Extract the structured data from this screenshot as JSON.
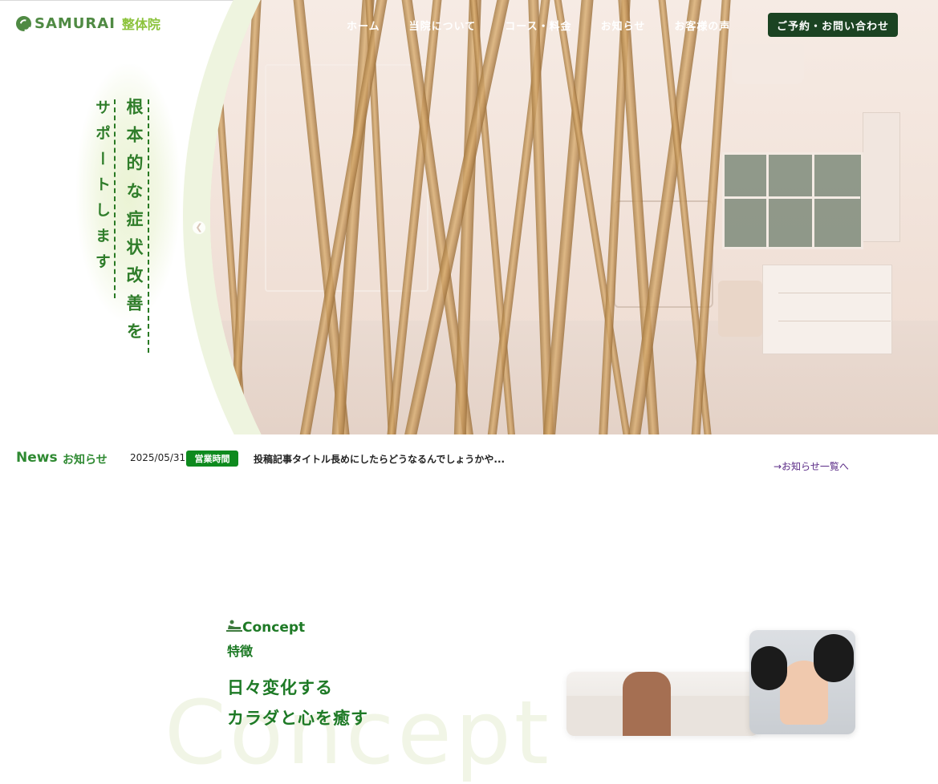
{
  "brand": {
    "logo_text": "SAMURAI",
    "logo_sub": "整体院",
    "color_primary": "#2f8a32",
    "color_logo": "#4f8a43",
    "color_logo_sub": "#8cc33c",
    "color_cta": "#1b4322"
  },
  "nav": {
    "items": [
      "ホーム",
      "当院について",
      "コース・料金",
      "お知らせ",
      "お客様の声"
    ],
    "cta_label": "ご予約・お問い合わせ"
  },
  "hero": {
    "tagline_main": "根本的な症状改善を",
    "tagline_sub": "サポートします",
    "prev_icon": "chevron-left-icon"
  },
  "news": {
    "title": "News",
    "subtitle": "お知らせ",
    "item": {
      "date": "2025/05/31",
      "category": "営業時間",
      "headline": "投稿記事タイトル長めにしたらどうなるんでしょうかや..."
    },
    "more_link": "→お知らせ一覧へ"
  },
  "concept": {
    "label": "Concept",
    "label_jp": "特徴",
    "heading_line1": "日々変化する",
    "heading_line2": "カラダと心を癒す",
    "watermark": "Concept",
    "icon": "massage-icon"
  }
}
